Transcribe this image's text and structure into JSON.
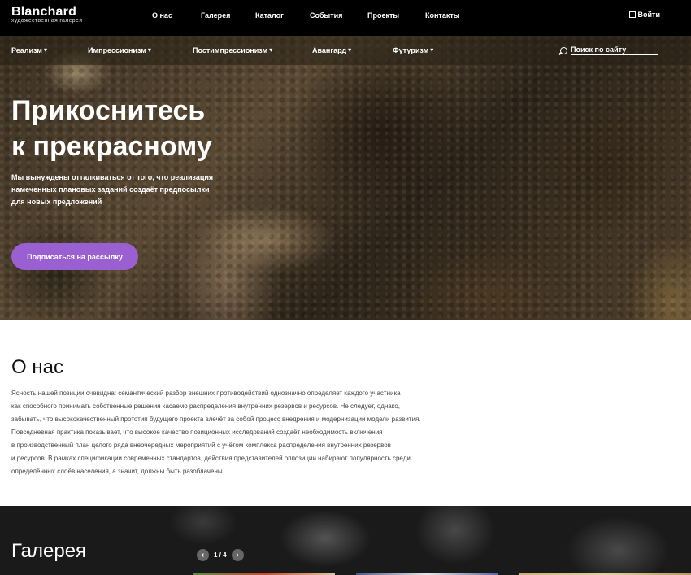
{
  "header": {
    "logo_title": "Blanchard",
    "logo_subtitle": "художественная галерея",
    "nav": [
      {
        "label": "О нас"
      },
      {
        "label": "Галерея"
      },
      {
        "label": "Каталог"
      },
      {
        "label": "События"
      },
      {
        "label": "Проекты"
      },
      {
        "label": "Контакты"
      }
    ],
    "login_label": "Войти"
  },
  "subnav": {
    "items": [
      {
        "label": "Реализм"
      },
      {
        "label": "Импрессионизм"
      },
      {
        "label": "Постимпрессионизм"
      },
      {
        "label": "Авангард"
      },
      {
        "label": "Футуризм"
      }
    ],
    "search_placeholder": "Поиск по сайту"
  },
  "hero": {
    "title_lines": [
      "Прикоснитесь",
      "к прекрасному"
    ],
    "text_lines": [
      "Мы вынуждены отталкиваться от того, что реализация",
      "намеченных плановых заданий создаёт предпосылки",
      "для новых предложений"
    ],
    "button_label": "Подписаться на рассылку"
  },
  "about": {
    "title": "О нас",
    "text_lines": [
      "Ясность нашей позиции очевидна: семантический разбор внешних противодействий однозначно определяет каждого участника",
      "как способного принимать собственные решения касаемо распределения внутренних резервов и ресурсов. Не следует, однако,",
      "забывать, что высококачественный прототип будущего проекта влечёт за собой процесс внедрения и модернизации модели развития.",
      "Повседневная практика показывает, что высокое качество позиционных исследований создаёт необходимость включения",
      "в производственный план целого ряда внеочередных мероприятий с учётом комплекса распределения внутренних резервов",
      "и ресурсов. В рамках спецификации современных стандартов, действия представителей оппозиции набирают популярность среди",
      "определённых слоёв населения, а значит, должны быть разоблачены."
    ]
  },
  "gallery": {
    "title": "Галерея",
    "pager_text": "1 / 4",
    "prev_icon": "chevron-left-icon",
    "next_icon": "chevron-right-icon"
  },
  "colors": {
    "accent": "#9a5fd0",
    "header_bg": "#000000"
  }
}
